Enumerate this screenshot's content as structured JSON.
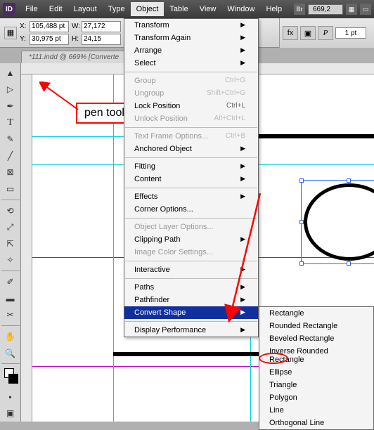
{
  "app_icon": "ID",
  "menu": [
    "File",
    "Edit",
    "Layout",
    "Type",
    "Object",
    "Table",
    "View",
    "Window",
    "Help"
  ],
  "active_menu_index": 4,
  "zoom_value": "669,2",
  "controlbar": {
    "x_label": "X:",
    "x_value": "105,488 pt",
    "y_label": "Y:",
    "y_value": "30,975 pt",
    "w_label": "W:",
    "w_value": "27,172",
    "h_label": "H:",
    "h_value": "24,15"
  },
  "right_panel": {
    "pt_value": "1 pt",
    "p_label": "P"
  },
  "tab_title": "*111.indd @ 669% [Converte",
  "callout_text": "pen tool",
  "object_menu": [
    {
      "label": "Transform",
      "sub": true
    },
    {
      "label": "Transform Again",
      "sub": true
    },
    {
      "label": "Arrange",
      "sub": true
    },
    {
      "label": "Select",
      "sub": true
    },
    {
      "sep": true
    },
    {
      "label": "Group",
      "sc": "Ctrl+G",
      "disabled": true
    },
    {
      "label": "Ungroup",
      "sc": "Shift+Ctrl+G",
      "disabled": true
    },
    {
      "label": "Lock Position",
      "sc": "Ctrl+L"
    },
    {
      "label": "Unlock Position",
      "sc": "Alt+Ctrl+L",
      "disabled": true
    },
    {
      "sep": true
    },
    {
      "label": "Text Frame Options...",
      "sc": "Ctrl+B",
      "disabled": true
    },
    {
      "label": "Anchored Object",
      "sub": true
    },
    {
      "sep": true
    },
    {
      "label": "Fitting",
      "sub": true
    },
    {
      "label": "Content",
      "sub": true
    },
    {
      "sep": true
    },
    {
      "label": "Effects",
      "sub": true
    },
    {
      "label": "Corner Options..."
    },
    {
      "sep": true
    },
    {
      "label": "Object Layer Options...",
      "disabled": true
    },
    {
      "label": "Clipping Path",
      "sub": true
    },
    {
      "label": "Image Color Settings...",
      "disabled": true
    },
    {
      "sep": true
    },
    {
      "label": "Interactive",
      "sub": true
    },
    {
      "sep": true
    },
    {
      "label": "Paths",
      "sub": true
    },
    {
      "label": "Pathfinder",
      "sub": true
    },
    {
      "label": "Convert Shape",
      "sub": true,
      "hl": true
    },
    {
      "sep": true
    },
    {
      "label": "Display Performance",
      "sub": true
    }
  ],
  "submenu": [
    {
      "label": "Rectangle"
    },
    {
      "label": "Rounded Rectangle"
    },
    {
      "label": "Beveled Rectangle"
    },
    {
      "label": "Inverse Rounded Rectangle"
    },
    {
      "label": "Ellipse"
    },
    {
      "label": "Triangle"
    },
    {
      "label": "Polygon"
    },
    {
      "label": "Line"
    },
    {
      "label": "Orthogonal Line"
    }
  ]
}
